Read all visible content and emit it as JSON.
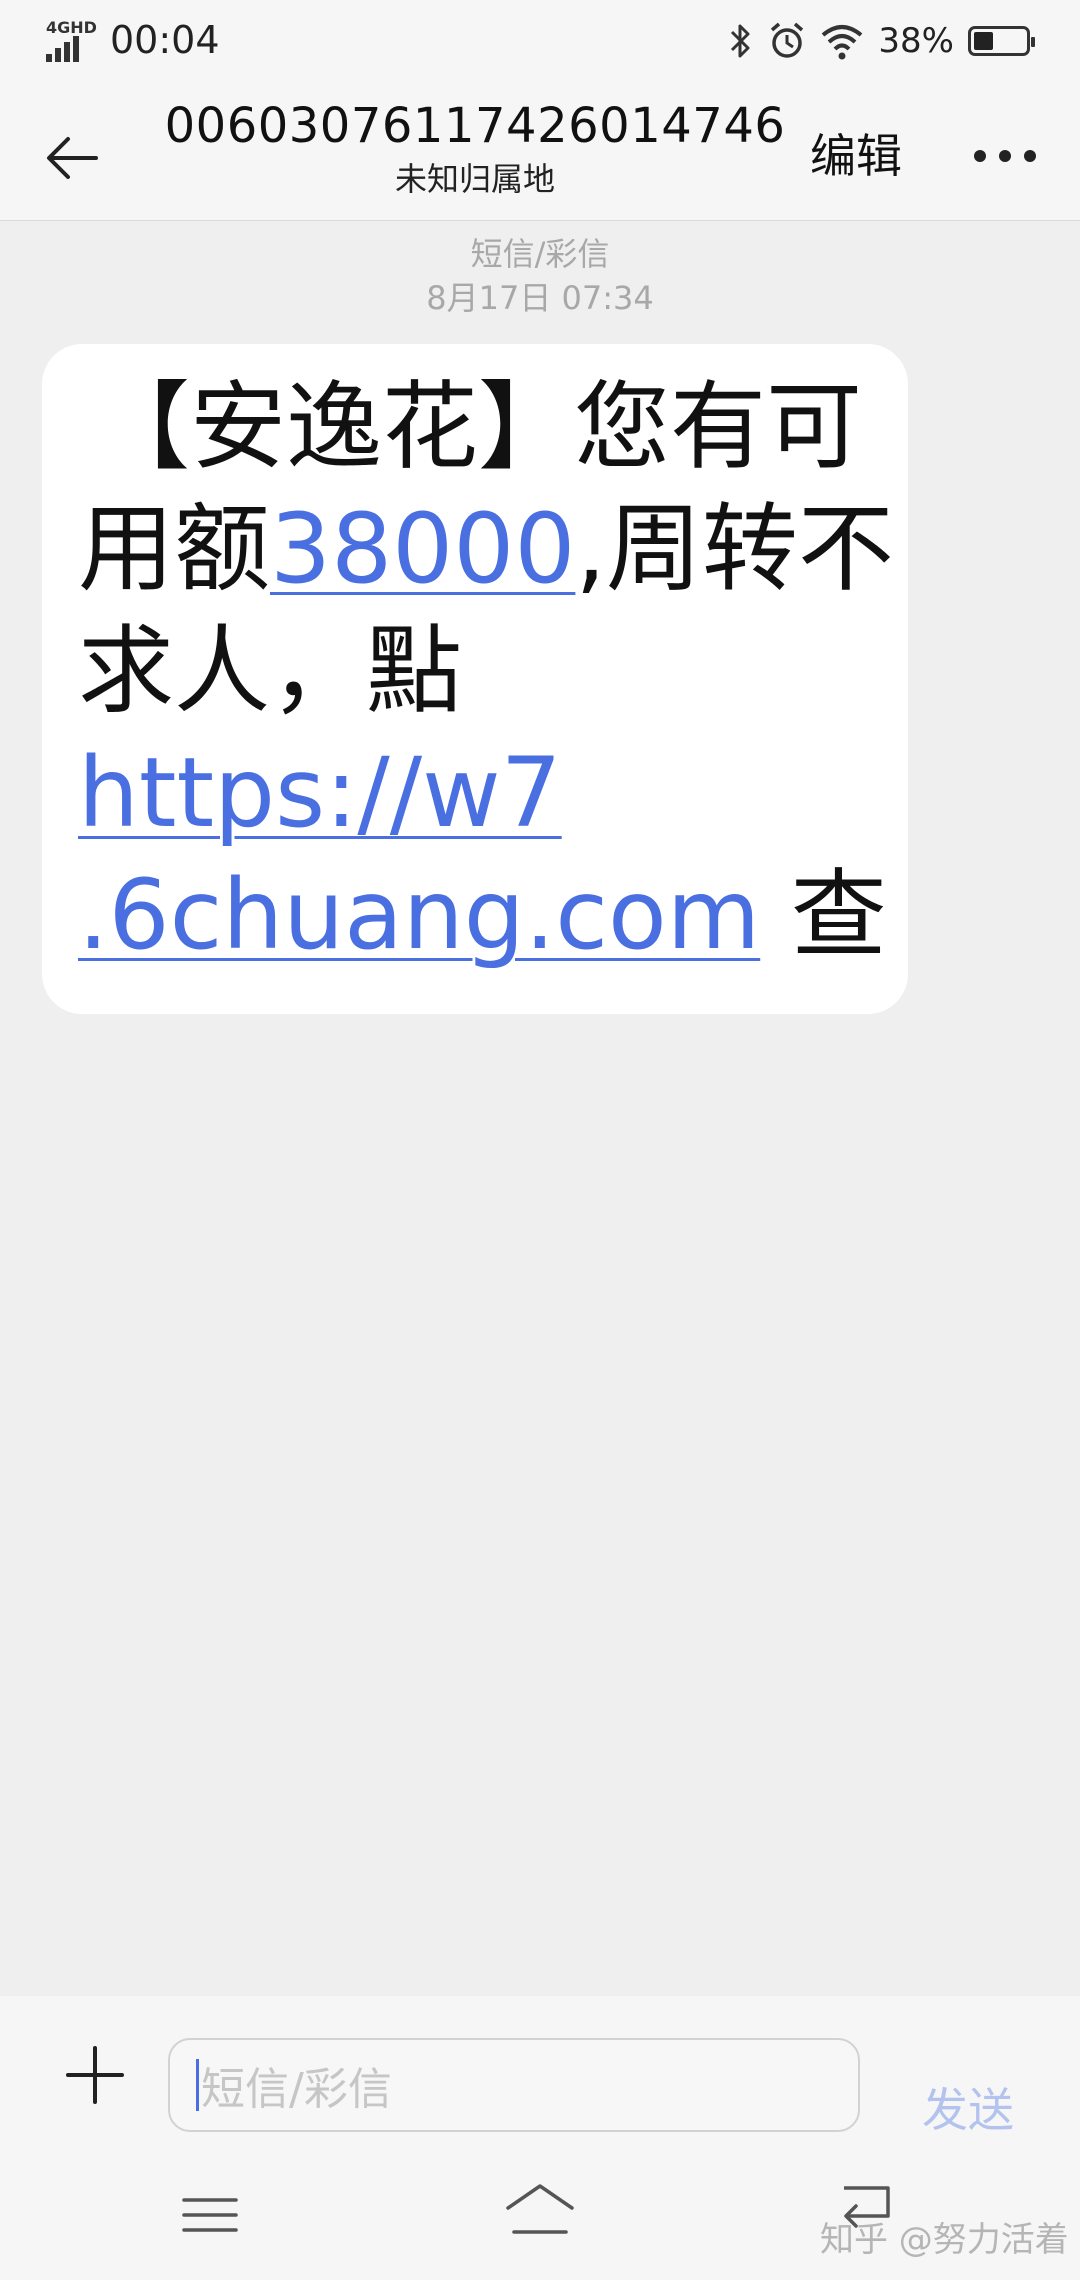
{
  "status_bar": {
    "network": "4GHD",
    "time": "00:04",
    "battery_percent": "38%",
    "battery_level": 0.38,
    "icons": [
      "signal-icon",
      "bluetooth-icon",
      "alarm-icon",
      "wifi-icon",
      "battery-icon"
    ]
  },
  "header": {
    "contact_number": "00603076117426014746",
    "contact_location": "未知归属地",
    "edit_label": "编辑",
    "back_icon": "back-arrow-icon",
    "more_icon": "more-icon"
  },
  "thread": {
    "message_type": "短信/彩信",
    "timestamp": "8月17日 07:34",
    "message": {
      "line1": "【安逸花】您有可",
      "line2_prefix": "用额",
      "amount": "38000",
      "line2_suffix": ",周转不",
      "line3": "求人，點",
      "link_line1": "https://w7",
      "link_line2": ".6chuang.com",
      "line5_suffix": " 查"
    }
  },
  "compose": {
    "add_icon": "plus-icon",
    "placeholder": "短信/彩信",
    "send_label": "发送"
  },
  "nav": {
    "menu_icon": "menu-icon",
    "home_icon": "home-icon",
    "back_icon": "nav-back-icon",
    "watermark": "知乎 @努力活着"
  },
  "colors": {
    "link": "#4a6fe0",
    "send_disabled": "#b3c3ee",
    "background": "#efefef",
    "bubble": "#ffffff"
  }
}
